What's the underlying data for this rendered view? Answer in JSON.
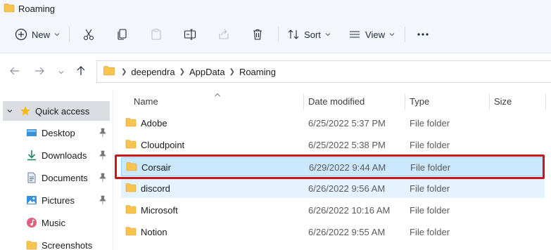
{
  "window": {
    "title": "Roaming"
  },
  "toolbar": {
    "new_label": "New",
    "sort_label": "Sort",
    "view_label": "View"
  },
  "address": {
    "crumbs": [
      "deependra",
      "AppData",
      "Roaming"
    ]
  },
  "sidebar": {
    "items": [
      {
        "label": "Quick access",
        "icon": "star-icon",
        "pinned": false
      },
      {
        "label": "Desktop",
        "icon": "desktop-icon",
        "pinned": true
      },
      {
        "label": "Downloads",
        "icon": "download-icon",
        "pinned": true
      },
      {
        "label": "Documents",
        "icon": "document-icon",
        "pinned": true
      },
      {
        "label": "Pictures",
        "icon": "picture-icon",
        "pinned": true
      },
      {
        "label": "Music",
        "icon": "music-icon",
        "pinned": false
      },
      {
        "label": "Screenshots",
        "icon": "folder-icon",
        "pinned": false
      }
    ]
  },
  "columns": [
    "Name",
    "Date modified",
    "Type",
    "Size"
  ],
  "files": [
    {
      "name": "Adobe",
      "date": "6/25/2022 5:37 PM",
      "type": "File folder"
    },
    {
      "name": "Cloudpoint",
      "date": "6/25/2022 5:38 PM",
      "type": "File folder"
    },
    {
      "name": "Corsair",
      "date": "6/29/2022 9:44 AM",
      "type": "File folder"
    },
    {
      "name": "discord",
      "date": "6/26/2022 9:56 AM",
      "type": "File folder"
    },
    {
      "name": "Microsoft",
      "date": "6/26/2022 10:16 AM",
      "type": "File folder"
    },
    {
      "name": "Notion",
      "date": "6/26/2022 9:55 AM",
      "type": "File folder"
    }
  ],
  "colors": {
    "selection": "#cce8ff",
    "hover": "#e5f3ff",
    "highlight_box": "#c8161d",
    "folder": "#f8c44f"
  }
}
